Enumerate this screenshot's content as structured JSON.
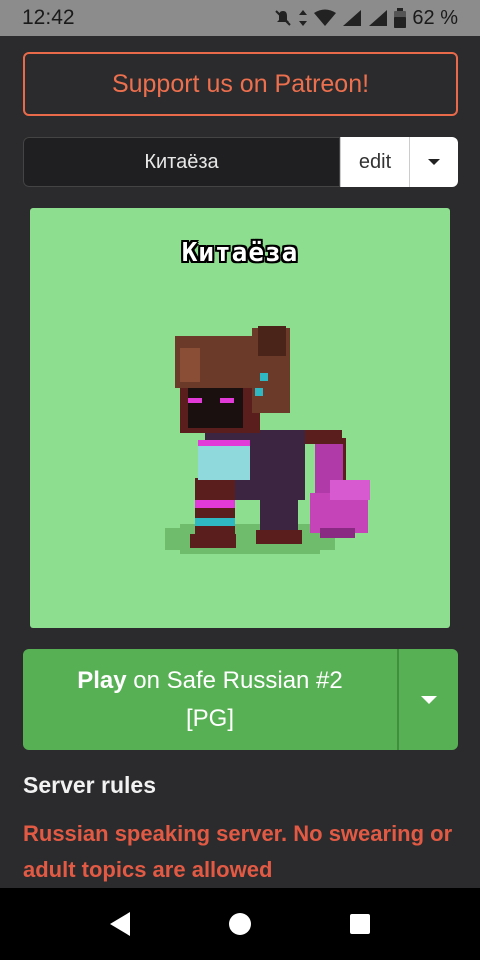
{
  "status": {
    "time": "12:42",
    "battery": "62 %"
  },
  "patreon": {
    "label": "Support us on Patreon!"
  },
  "character": {
    "name": "Китаёза",
    "edit_label": "edit"
  },
  "preview": {
    "pony_name": "Китаёза",
    "background_color": "#8ddf8f"
  },
  "play": {
    "verb": "Play",
    "server_prefix": " on Safe Russian #2",
    "rating": "[PG]",
    "accent": "#58b055"
  },
  "rules": {
    "title": "Server rules",
    "text": "Russian speaking server. No swearing or adult topics are allowed"
  },
  "icons": {
    "status": [
      "mute-icon",
      "data-arrows-icon",
      "wifi-icon",
      "signal-icon",
      "signal-icon",
      "battery-icon"
    ],
    "nav": [
      "back-icon",
      "home-icon",
      "recents-icon"
    ]
  }
}
